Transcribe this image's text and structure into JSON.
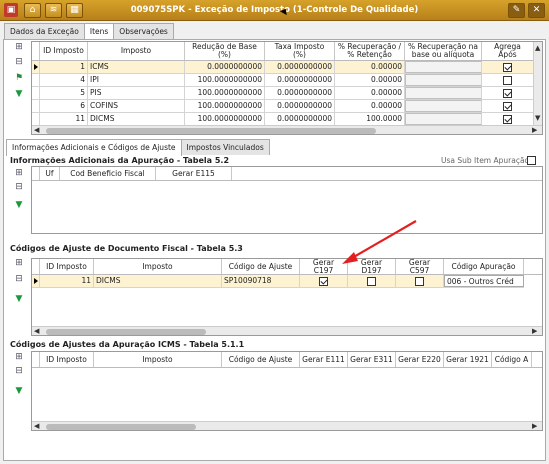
{
  "window": {
    "title": "009075SPK - Exceção de Imposto (1-Controle De Qualidade)"
  },
  "top_tabs": [
    {
      "label": "Dados da Exceção",
      "active": false
    },
    {
      "label": "Itens",
      "active": true
    },
    {
      "label": "Observações",
      "active": false
    }
  ],
  "items_grid": {
    "columns": [
      "ID Imposto",
      "Imposto",
      "Redução de Base (%)",
      "Taxa Imposto (%)",
      "% Recuperação / % Retenção",
      "% Recuperação na base ou alíquota",
      "Agrega Após"
    ],
    "rows": [
      {
        "id": "1",
        "imposto": "ICMS",
        "reducao": "0.0000000000",
        "taxa": "0.0000000000",
        "recuperacao": "0.00000",
        "agrega": true
      },
      {
        "id": "4",
        "imposto": "IPI",
        "reducao": "100.0000000000",
        "taxa": "0.0000000000",
        "recuperacao": "0.00000",
        "agrega": false
      },
      {
        "id": "5",
        "imposto": "PIS",
        "reducao": "100.0000000000",
        "taxa": "0.0000000000",
        "recuperacao": "0.00000",
        "agrega": true
      },
      {
        "id": "6",
        "imposto": "COFINS",
        "reducao": "100.0000000000",
        "taxa": "0.0000000000",
        "recuperacao": "0.00000",
        "agrega": true
      },
      {
        "id": "11",
        "imposto": "DICMS",
        "reducao": "100.0000000000",
        "taxa": "0.0000000000",
        "recuperacao": "100.0000",
        "agrega": true
      }
    ]
  },
  "sub_tabs": [
    {
      "label": "Informações Adicionais e Códigos de Ajuste",
      "active": true
    },
    {
      "label": "Impostos Vinculados",
      "active": false
    }
  ],
  "section1": {
    "title": "Informações Adicionais da Apuração - Tabela 5.2",
    "use_sub_item_label": "Usa Sub Item Apuração",
    "columns": [
      "Uf",
      "Cod Beneficio Fiscal",
      "Gerar E115"
    ]
  },
  "section2": {
    "title": "Códigos de Ajuste de Documento Fiscal - Tabela 5.3",
    "columns": [
      "ID Imposto",
      "Imposto",
      "Código de Ajuste",
      "Gerar C197",
      "Gerar D197",
      "Gerar C597",
      "Código Apuração"
    ],
    "rows": [
      {
        "id": "11",
        "imposto": "DICMS",
        "codigo": "SP10090718",
        "c197": true,
        "d197": false,
        "c597": false,
        "apuracao": "006 - Outros Créd"
      }
    ]
  },
  "section3": {
    "title": "Códigos de Ajustes da Apuração ICMS - Tabela 5.1.1",
    "columns": [
      "ID Imposto",
      "Imposto",
      "Código de Ajuste",
      "Gerar E111",
      "Gerar E311",
      "Gerar E220",
      "Gerar 1921",
      "Código A"
    ]
  },
  "icons": [
    "grid-add-icon",
    "grid-edit-icon",
    "grid-delete-icon",
    "flag-icon",
    "download-arrow-icon"
  ],
  "colors": {
    "titlebar": "#c8921f",
    "selected_row": "#fdf3d2",
    "annotation_arrow": "#e32020"
  }
}
